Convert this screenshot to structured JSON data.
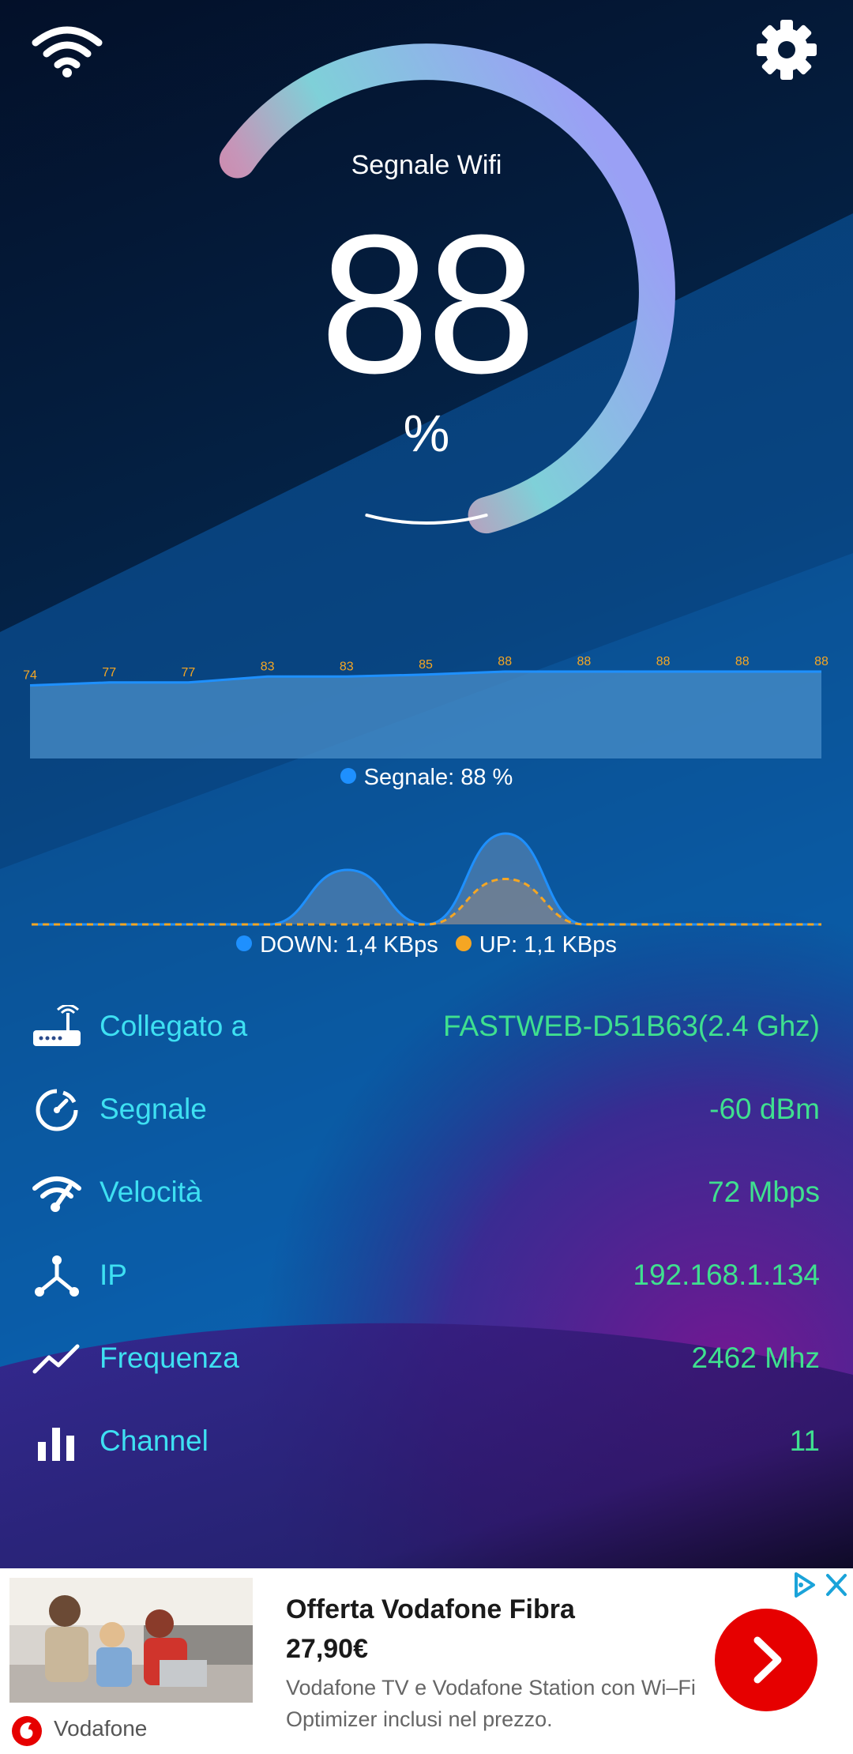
{
  "colors": {
    "accent_label": "#3ee0f2",
    "accent_value": "#3fe08f",
    "down_series": "#1e90ff",
    "up_series": "#f5a623",
    "ad_cta": "#e60000"
  },
  "header": {
    "wifi_icon": "wifi-icon",
    "settings_icon": "gear-icon"
  },
  "gauge": {
    "label": "Segnale Wifi",
    "value": "88",
    "unit": "%",
    "level": 0.88
  },
  "chart_data": [
    {
      "type": "area",
      "x": [
        1,
        2,
        3,
        4,
        5,
        6,
        7,
        8,
        9,
        10,
        11
      ],
      "values": [
        74,
        77,
        77,
        83,
        83,
        85,
        88,
        88,
        88,
        88,
        88
      ],
      "data_labels": [
        "74",
        "77",
        "77",
        "83",
        "83",
        "85",
        "88",
        "88",
        "88",
        "88",
        "88"
      ],
      "legend": "Segnale: 88 %",
      "grid": false
    },
    {
      "type": "area",
      "series": [
        {
          "name": "DOWN",
          "values": [
            0,
            0,
            0,
            0,
            0.6,
            0,
            1.0,
            0,
            0,
            0,
            0
          ]
        },
        {
          "name": "UP",
          "values": [
            0,
            0,
            0,
            0,
            0,
            0,
            0.5,
            0,
            0,
            0,
            0
          ]
        }
      ],
      "legend": [
        {
          "text": "DOWN: 1,4 KBps"
        },
        {
          "text": "UP: 1,1 KBps"
        }
      ],
      "grid": false
    }
  ],
  "info": [
    {
      "icon": "router-icon",
      "label": "Collegato a",
      "value": "FASTWEB-D51B63(2.4 Ghz)"
    },
    {
      "icon": "gauge-icon",
      "label": "Segnale",
      "value": "-60 dBm"
    },
    {
      "icon": "wifi-speed-icon",
      "label": "Velocità",
      "value": "72 Mbps"
    },
    {
      "icon": "network-icon",
      "label": "IP",
      "value": "192.168.1.134"
    },
    {
      "icon": "trend-icon",
      "label": "Frequenza",
      "value": "2462 Mhz"
    },
    {
      "icon": "bar-chart-icon",
      "label": "Channel",
      "value": "11"
    }
  ],
  "ad": {
    "title": "Offerta Vodafone Fibra",
    "price": "27,90€",
    "description": "Vodafone TV e Vodafone Station con Wi–Fi Optimizer inclusi nel prezzo.",
    "brand": "Vodafone",
    "cta_icon": "chevron-right-icon",
    "choices_icon": "adchoices-icon",
    "close_icon": "close-icon"
  }
}
